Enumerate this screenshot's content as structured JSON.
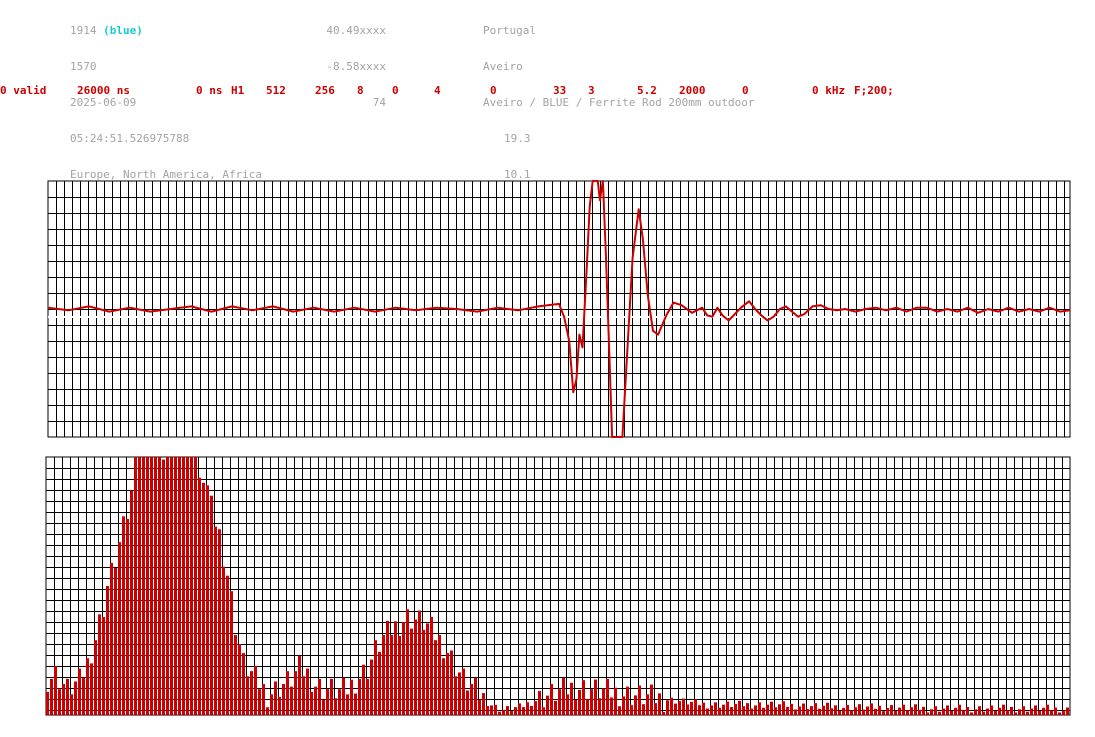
{
  "header": {
    "station_id": "1914",
    "station_color": "(blue)",
    "station_number": "1570",
    "date": "2025-06-09",
    "time": "05:24:51.526975788",
    "regions": "Europe, North America, Africa",
    "latitude": "40.49xxxx",
    "longitude": "-8.58xxxx",
    "altitude": "74",
    "country": "Portugal",
    "city": "Aveiro",
    "description": "Aveiro / BLUE / Ferrite Rod 200mm outdoor",
    "value_1": "19.3",
    "value_2": "10.1"
  },
  "params": {
    "valid": "0 valid",
    "duration": "26000 ns",
    "offset": "0 ns",
    "channel": "H1",
    "p1": "512",
    "p2": "256",
    "p3": "8",
    "p4": "0",
    "p5": "4",
    "p6": "0",
    "p7": "33",
    "p8": "3",
    "p9": "5.2",
    "p10": "2000",
    "p11": "0",
    "p12": "0 kHz",
    "p13": "F;200;"
  },
  "colors": {
    "trace": "#cc0000",
    "bars": "#cc0000",
    "grid": "#000000",
    "header_text": "#a3a3a3",
    "station_tag": "#17c8d8"
  },
  "chart_data": [
    {
      "type": "line",
      "grid": true,
      "clipped": true,
      "x_range": [
        0,
        1
      ],
      "y_range": [
        -1,
        1
      ],
      "series": [
        {
          "points": [
            [
              0.0,
              0.01
            ],
            [
              0.02,
              -0.01
            ],
            [
              0.04,
              0.02
            ],
            [
              0.06,
              -0.02
            ],
            [
              0.08,
              0.01
            ],
            [
              0.1,
              -0.02
            ],
            [
              0.12,
              0.0
            ],
            [
              0.14,
              0.02
            ],
            [
              0.16,
              -0.02
            ],
            [
              0.18,
              0.02
            ],
            [
              0.2,
              -0.01
            ],
            [
              0.22,
              0.02
            ],
            [
              0.24,
              -0.02
            ],
            [
              0.26,
              0.01
            ],
            [
              0.28,
              -0.02
            ],
            [
              0.3,
              0.01
            ],
            [
              0.32,
              -0.02
            ],
            [
              0.34,
              0.01
            ],
            [
              0.36,
              -0.01
            ],
            [
              0.38,
              0.01
            ],
            [
              0.4,
              0.0
            ],
            [
              0.42,
              -0.02
            ],
            [
              0.44,
              0.01
            ],
            [
              0.46,
              -0.01
            ],
            [
              0.48,
              0.02
            ],
            [
              0.5,
              0.04
            ],
            [
              0.505,
              -0.06
            ],
            [
              0.51,
              -0.25
            ],
            [
              0.514,
              -0.65
            ],
            [
              0.517,
              -0.55
            ],
            [
              0.52,
              -0.2
            ],
            [
              0.523,
              -0.3
            ],
            [
              0.527,
              0.3
            ],
            [
              0.53,
              0.8
            ],
            [
              0.533,
              1.0
            ],
            [
              0.538,
              1.0
            ],
            [
              0.54,
              0.85
            ],
            [
              0.543,
              1.0
            ],
            [
              0.546,
              0.4
            ],
            [
              0.549,
              -0.3
            ],
            [
              0.552,
              -1.0
            ],
            [
              0.562,
              -1.0
            ],
            [
              0.567,
              -0.3
            ],
            [
              0.572,
              0.4
            ],
            [
              0.578,
              0.78
            ],
            [
              0.582,
              0.55
            ],
            [
              0.587,
              0.1
            ],
            [
              0.592,
              -0.17
            ],
            [
              0.597,
              -0.2
            ],
            [
              0.605,
              -0.05
            ],
            [
              0.612,
              0.05
            ],
            [
              0.62,
              0.03
            ],
            [
              0.63,
              -0.03
            ],
            [
              0.64,
              0.01
            ],
            [
              0.645,
              -0.05
            ],
            [
              0.65,
              -0.06
            ],
            [
              0.655,
              0.01
            ],
            [
              0.66,
              -0.05
            ],
            [
              0.666,
              -0.09
            ],
            [
              0.672,
              -0.04
            ],
            [
              0.678,
              0.01
            ],
            [
              0.686,
              0.06
            ],
            [
              0.692,
              0.0
            ],
            [
              0.698,
              -0.05
            ],
            [
              0.704,
              -0.09
            ],
            [
              0.71,
              -0.06
            ],
            [
              0.716,
              0.0
            ],
            [
              0.722,
              0.02
            ],
            [
              0.728,
              -0.02
            ],
            [
              0.734,
              -0.06
            ],
            [
              0.74,
              -0.04
            ],
            [
              0.748,
              0.02
            ],
            [
              0.756,
              0.03
            ],
            [
              0.764,
              0.0
            ],
            [
              0.772,
              -0.01
            ],
            [
              0.78,
              0.0
            ],
            [
              0.79,
              -0.02
            ],
            [
              0.8,
              0.0
            ],
            [
              0.81,
              0.01
            ],
            [
              0.82,
              -0.01
            ],
            [
              0.83,
              0.01
            ],
            [
              0.84,
              -0.02
            ],
            [
              0.85,
              0.01
            ],
            [
              0.86,
              0.01
            ],
            [
              0.87,
              -0.02
            ],
            [
              0.88,
              0.0
            ],
            [
              0.89,
              -0.02
            ],
            [
              0.9,
              0.01
            ],
            [
              0.91,
              -0.03
            ],
            [
              0.92,
              0.0
            ],
            [
              0.93,
              -0.02
            ],
            [
              0.94,
              0.01
            ],
            [
              0.95,
              -0.02
            ],
            [
              0.96,
              0.0
            ],
            [
              0.97,
              -0.02
            ],
            [
              0.98,
              0.01
            ],
            [
              0.99,
              -0.02
            ],
            [
              1.0,
              -0.01
            ]
          ]
        }
      ]
    },
    {
      "type": "bar",
      "grid": true,
      "bins": 256,
      "ylim": [
        0,
        1
      ],
      "envelope": [
        [
          0,
          0.14
        ],
        [
          2,
          0.16
        ],
        [
          5,
          0.1
        ],
        [
          8,
          0.13
        ],
        [
          10,
          0.2
        ],
        [
          12,
          0.3
        ],
        [
          14,
          0.42
        ],
        [
          15,
          0.5
        ],
        [
          17,
          0.6
        ],
        [
          20,
          0.78
        ],
        [
          21,
          0.85
        ],
        [
          22,
          1.0
        ],
        [
          28,
          1.0
        ],
        [
          29,
          0.99
        ],
        [
          30,
          1.0
        ],
        [
          37,
          1.0
        ],
        [
          38,
          0.92
        ],
        [
          39,
          0.9
        ],
        [
          40,
          0.88
        ],
        [
          41,
          0.8
        ],
        [
          43,
          0.7
        ],
        [
          45,
          0.55
        ],
        [
          47,
          0.35
        ],
        [
          49,
          0.2
        ],
        [
          51,
          0.16
        ],
        [
          53,
          0.12
        ],
        [
          55,
          0.08
        ],
        [
          57,
          0.1
        ],
        [
          59,
          0.12
        ],
        [
          61,
          0.14
        ],
        [
          63,
          0.18
        ],
        [
          65,
          0.16
        ],
        [
          67,
          0.12
        ],
        [
          69,
          0.1
        ],
        [
          71,
          0.1
        ],
        [
          73,
          0.09
        ],
        [
          75,
          0.1
        ],
        [
          78,
          0.15
        ],
        [
          80,
          0.18
        ],
        [
          82,
          0.25
        ],
        [
          84,
          0.3
        ],
        [
          86,
          0.33
        ],
        [
          89,
          0.37
        ],
        [
          90,
          0.38
        ],
        [
          92,
          0.37
        ],
        [
          94,
          0.36
        ],
        [
          96,
          0.33
        ],
        [
          98,
          0.29
        ],
        [
          100,
          0.25
        ],
        [
          102,
          0.19
        ],
        [
          104,
          0.14
        ],
        [
          106,
          0.11
        ],
        [
          108,
          0.08
        ],
        [
          110,
          0.05
        ],
        [
          112,
          0.03
        ],
        [
          114,
          0.02
        ],
        [
          118,
          0.03
        ],
        [
          121,
          0.05
        ],
        [
          124,
          0.07
        ],
        [
          128,
          0.09
        ],
        [
          132,
          0.11
        ],
        [
          136,
          0.1
        ],
        [
          140,
          0.09
        ],
        [
          145,
          0.08
        ],
        [
          150,
          0.07
        ],
        [
          155,
          0.06
        ],
        [
          160,
          0.05
        ],
        [
          165,
          0.04
        ],
        [
          170,
          0.04
        ],
        [
          180,
          0.04
        ],
        [
          190,
          0.035
        ],
        [
          200,
          0.03
        ],
        [
          210,
          0.03
        ],
        [
          220,
          0.025
        ],
        [
          230,
          0.025
        ],
        [
          240,
          0.025
        ],
        [
          250,
          0.025
        ],
        [
          255,
          0.02
        ]
      ]
    }
  ]
}
